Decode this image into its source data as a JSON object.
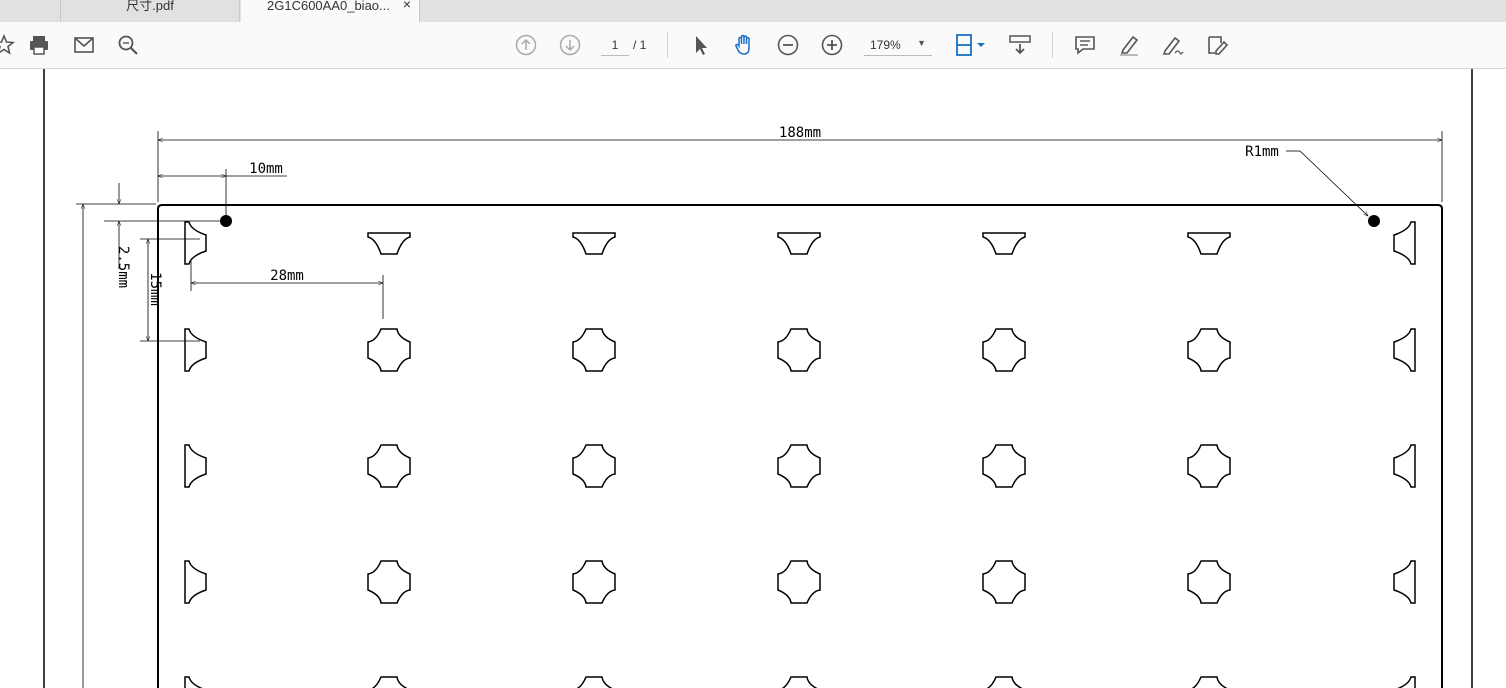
{
  "tabs": [
    {
      "label": "尺寸.pdf",
      "active": false
    },
    {
      "label": "2G1C600AA0_biao...",
      "active": true
    }
  ],
  "tab_close_glyph": "×",
  "toolbar": {
    "icons_left": [
      "bookmark-star-icon",
      "print-icon",
      "email-icon",
      "search-zoom-icon"
    ],
    "page_current": "1",
    "page_total": "/ 1",
    "zoom_value": "179%",
    "icons_center": [
      "prev-page-icon",
      "next-page-icon",
      "select-cursor-icon",
      "hand-tool-icon",
      "zoom-out-icon",
      "zoom-in-icon",
      "fit-page-icon",
      "scroll-mode-icon"
    ],
    "icons_right": [
      "comment-icon",
      "highlight-icon",
      "sign-icon",
      "fill-sign-icon"
    ]
  },
  "drawing": {
    "dim_overall_width": "188mm",
    "dim_margin": "10mm",
    "dim_pitch": "28mm",
    "dim_corner_radius": "R1mm",
    "dim_offset_vertical": "2.5mm",
    "dim_row_pitch": "15mm"
  }
}
